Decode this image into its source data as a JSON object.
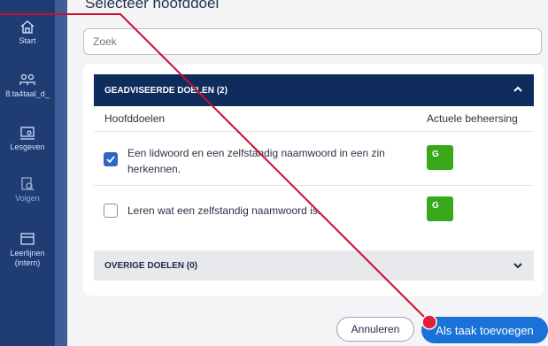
{
  "sidebar": {
    "items": [
      {
        "label": "Start",
        "icon": "home-icon"
      },
      {
        "label": "8.ta4taal_d_",
        "icon": "group-icon"
      },
      {
        "label": "Lesgeven",
        "icon": "teach-icon"
      },
      {
        "label": "Volgen",
        "icon": "track-icon"
      },
      {
        "label": "Leerlijnen (intern)",
        "icon": "learning-lines-icon"
      }
    ]
  },
  "main": {
    "heading": "Selecteer hoofddoel",
    "search_placeholder": "Zoek",
    "advised": {
      "title": "GEADVISEERDE DOELEN (2)",
      "col_goals": "Hoofddoelen",
      "col_mastery": "Actuele beheersing",
      "rows": [
        {
          "text": "Een lidwoord en een zelfstandig naamwoord in een zin herkennen.",
          "checked": true,
          "badge": "G"
        },
        {
          "text": "Leren wat een zelfstandig naamwoord is.",
          "checked": false,
          "badge": "G"
        }
      ]
    },
    "other": {
      "title": "OVERIGE DOELEN (0)"
    }
  },
  "footer": {
    "cancel_label": "Annuleren",
    "add_label": "Als taak toevoegen"
  },
  "colors": {
    "accent": "#1a72d8",
    "header_bar": "#0f2c5c",
    "badge": "#36a81a",
    "sidebar": "#1f3d73",
    "annotation": "#c8102e"
  }
}
